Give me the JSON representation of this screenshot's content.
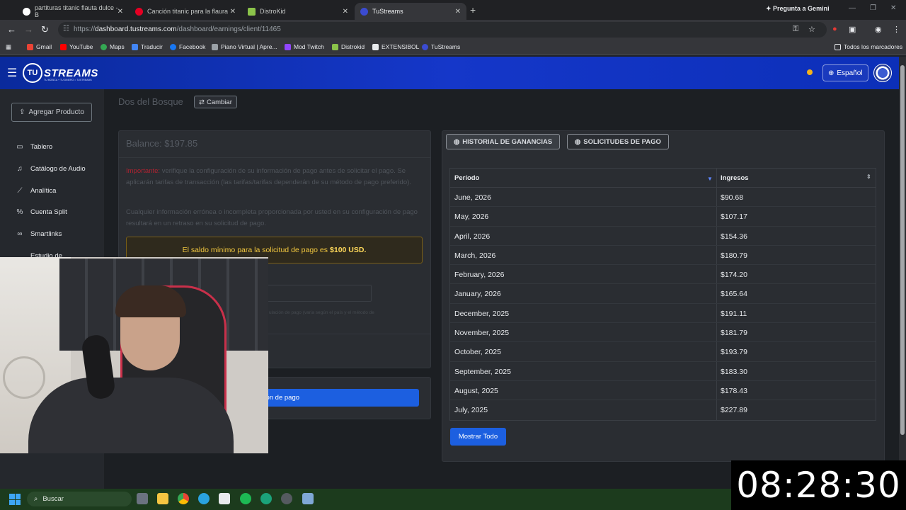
{
  "browser": {
    "tabs": [
      {
        "title": "partituras titanic flauta dulce - B",
        "color": "#ffffff"
      },
      {
        "title": "Canción titanic para la flaura",
        "color": "#e60023"
      },
      {
        "title": "DistroKid",
        "color": "#8bc34a"
      },
      {
        "title": "TuStreams",
        "color": "#3b4bd1"
      }
    ],
    "new_tab_icon": "plus-icon",
    "gemini_label": "Pregunta a Gemini",
    "url": {
      "prefix": "https://",
      "domain": "dashboard.tustreams.com",
      "path": "/dashboard/earnings/client/11465"
    },
    "bookmarks": [
      {
        "label": "Gmail",
        "color": "#ea4335"
      },
      {
        "label": "YouTube",
        "color": "#ff0000"
      },
      {
        "label": "Maps",
        "color": "#34a853"
      },
      {
        "label": "Traducir",
        "color": "#4285f4"
      },
      {
        "label": "Facebook",
        "color": "#1877f2"
      },
      {
        "label": "Piano Virtual | Apre...",
        "color": "#9aa0a6"
      },
      {
        "label": "Mod Twitch",
        "color": "#9146ff"
      },
      {
        "label": "Distrokid",
        "color": "#8bc34a"
      },
      {
        "label": "EXTENSIBOL",
        "color": "#e8eaed"
      },
      {
        "label": "TuStreams",
        "color": "#3b4bd1"
      }
    ],
    "all_bookmarks": "Todos los marcadores"
  },
  "header": {
    "logo_text": "STREAMS",
    "logo_badge": "TU",
    "logo_tagline": "TU MÚSICA + TU DINERO = TUSTREAMS",
    "language": "Español"
  },
  "sidebar": {
    "add_product": "Agregar Producto",
    "items": [
      {
        "label": "Tablero",
        "icon": "laptop-icon"
      },
      {
        "label": "Catálogo de Audio",
        "icon": "headphones-icon"
      },
      {
        "label": "Analítica",
        "icon": "chart-line-icon"
      },
      {
        "label": "Cuenta Split",
        "icon": "percent-icon"
      },
      {
        "label": "Smartlinks",
        "icon": "link-icon"
      },
      {
        "label": "Estudio de",
        "icon": "studio-icon"
      }
    ]
  },
  "main": {
    "client_name": "Dos del Bosque",
    "change_label": "Cambiar",
    "balance": "Balance: $197.85",
    "warning_important": "Importante:",
    "warning_text": "verifique la configuración de su información de pago antes de solicitar el pago. Se aplicarán tarifas de transacción (las tarifas/tarifas dependerán de su método de pago preferido).",
    "info_text": "Cualquier información errónea o incompleta proporcionada por usted en su configuración de pago resultará en un retraso en su solicitud de pago.",
    "min_notice": "El saldo mínimo para la solicitud de pago es",
    "min_amount": "$100 USD.",
    "faint_note": "ulación de pago (varia según el país y el método de",
    "payment_button": "ormación de pago"
  },
  "earnings": {
    "tab_history": "HISTORIAL DE GANANCIAS",
    "tab_requests": "SOLICITUDES DE PAGO",
    "col_period": "Período",
    "col_income": "Ingresos",
    "rows": [
      {
        "period": "June, 2026",
        "income": "$90.68"
      },
      {
        "period": "May, 2026",
        "income": "$107.17"
      },
      {
        "period": "April, 2026",
        "income": "$154.36"
      },
      {
        "period": "March, 2026",
        "income": "$180.79"
      },
      {
        "period": "February, 2026",
        "income": "$174.20"
      },
      {
        "period": "January, 2026",
        "income": "$165.64"
      },
      {
        "period": "December, 2025",
        "income": "$191.11"
      },
      {
        "period": "November, 2025",
        "income": "$181.79"
      },
      {
        "period": "October, 2025",
        "income": "$193.79"
      },
      {
        "period": "September, 2025",
        "income": "$183.30"
      },
      {
        "period": "August, 2025",
        "income": "$178.43"
      },
      {
        "period": "July, 2025",
        "income": "$227.89"
      }
    ],
    "show_all": "Mostrar Todo"
  },
  "taskbar": {
    "search_placeholder": "Buscar"
  },
  "clock": "08:28:30"
}
